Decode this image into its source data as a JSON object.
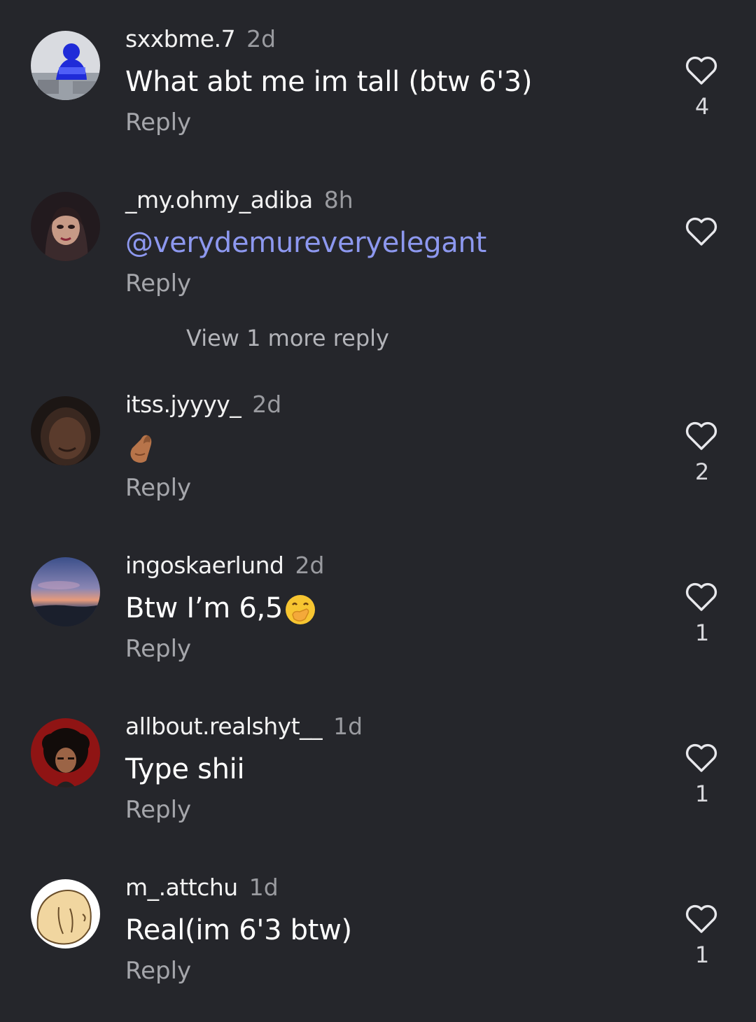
{
  "comments": [
    {
      "username": "sxxbme.7",
      "time": "2d",
      "text": "What abt me im tall (btw 6'3)",
      "reply_label": "Reply",
      "likes": "4"
    },
    {
      "username": "_my.ohmy_adiba",
      "time": "8h",
      "text": "@verydemureveryelegant",
      "reply_label": "Reply",
      "likes": ""
    },
    {
      "username": "itss.jyyyy_",
      "time": "2d",
      "text": "",
      "emoji": "pinched-fingers-emoji",
      "reply_label": "Reply",
      "likes": "2"
    },
    {
      "username": "ingoskaerlund",
      "time": "2d",
      "text": "Btw I’m 6,5",
      "emoji": "hand-over-mouth-emoji",
      "reply_label": "Reply",
      "likes": "1"
    },
    {
      "username": "allbout.realshyt__",
      "time": "1d",
      "text": "Type shii",
      "reply_label": "Reply",
      "likes": "1"
    },
    {
      "username": "m_.attchu",
      "time": "1d",
      "text": "Real(im 6'3 btw)",
      "reply_label": "Reply",
      "likes": "1"
    }
  ],
  "view_more_label": "View 1 more reply",
  "colors": {
    "background": "#25262b",
    "mention": "#8d98ef",
    "secondary_text": "#a5a6ab"
  }
}
